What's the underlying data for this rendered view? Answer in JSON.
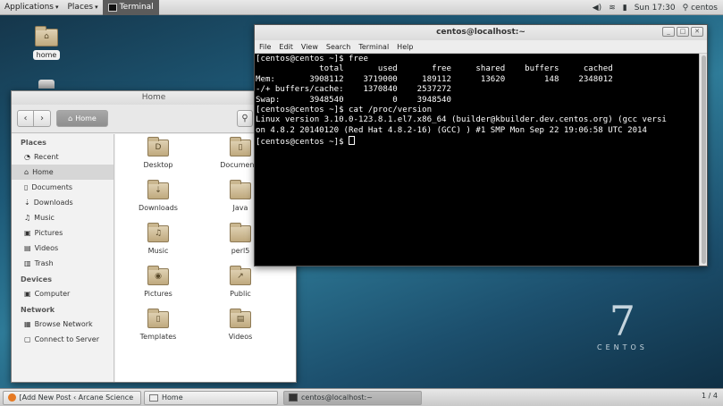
{
  "topbar": {
    "applications": "Applications",
    "places": "Places",
    "task": "Terminal",
    "clock": "Sun 17:30",
    "user": "centos"
  },
  "desktop": {
    "home_label": "home"
  },
  "nautilus": {
    "title": "Home",
    "path_button": "Home",
    "sidebar": {
      "places_header": "Places",
      "places": [
        {
          "label": "Recent",
          "icon": "◔"
        },
        {
          "label": "Home",
          "icon": "⌂"
        },
        {
          "label": "Documents",
          "icon": "▯"
        },
        {
          "label": "Downloads",
          "icon": "⇣"
        },
        {
          "label": "Music",
          "icon": "♫"
        },
        {
          "label": "Pictures",
          "icon": "▣"
        },
        {
          "label": "Videos",
          "icon": "▤"
        },
        {
          "label": "Trash",
          "icon": "▥"
        }
      ],
      "devices_header": "Devices",
      "devices": [
        {
          "label": "Computer",
          "icon": "▣"
        }
      ],
      "network_header": "Network",
      "network": [
        {
          "label": "Browse Network",
          "icon": "▦"
        },
        {
          "label": "Connect to Server",
          "icon": "▢"
        }
      ]
    },
    "folders": [
      {
        "label": "Desktop",
        "emblem": "D"
      },
      {
        "label": "Documents",
        "emblem": "▯"
      },
      {
        "label": "Downloads",
        "emblem": "⇣"
      },
      {
        "label": "Java",
        "emblem": ""
      },
      {
        "label": "Music",
        "emblem": "♫"
      },
      {
        "label": "perl5",
        "emblem": ""
      },
      {
        "label": "Pictures",
        "emblem": "◉"
      },
      {
        "label": "Public",
        "emblem": "↗"
      },
      {
        "label": "Templates",
        "emblem": "▯"
      },
      {
        "label": "Videos",
        "emblem": "▤"
      }
    ]
  },
  "terminal": {
    "title": "centos@localhost:~",
    "menu": [
      "File",
      "Edit",
      "View",
      "Search",
      "Terminal",
      "Help"
    ],
    "lines": [
      "[centos@centos ~]$ free",
      "             total       used       free     shared    buffers     cached",
      "Mem:       3908112    3719000     189112      13620        148    2348012",
      "-/+ buffers/cache:    1370840    2537272",
      "Swap:      3948540          0    3948540",
      "[centos@centos ~]$ cat /proc/version",
      "Linux version 3.10.0-123.8.1.el7.x86_64 (builder@kbuilder.dev.centos.org) (gcc versi",
      "on 4.8.2 20140120 (Red Hat 4.8.2-16) (GCC) ) #1 SMP Mon Sep 22 19:06:58 UTC 2014"
    ],
    "prompt": "[centos@centos ~]$ "
  },
  "brand": {
    "numeral": "7",
    "word": "CENTOS"
  },
  "taskbar": {
    "tasks": [
      "[Add New Post ‹ Arcane Science ...",
      "Home",
      "centos@localhost:~"
    ],
    "pager": "1 / 4"
  }
}
